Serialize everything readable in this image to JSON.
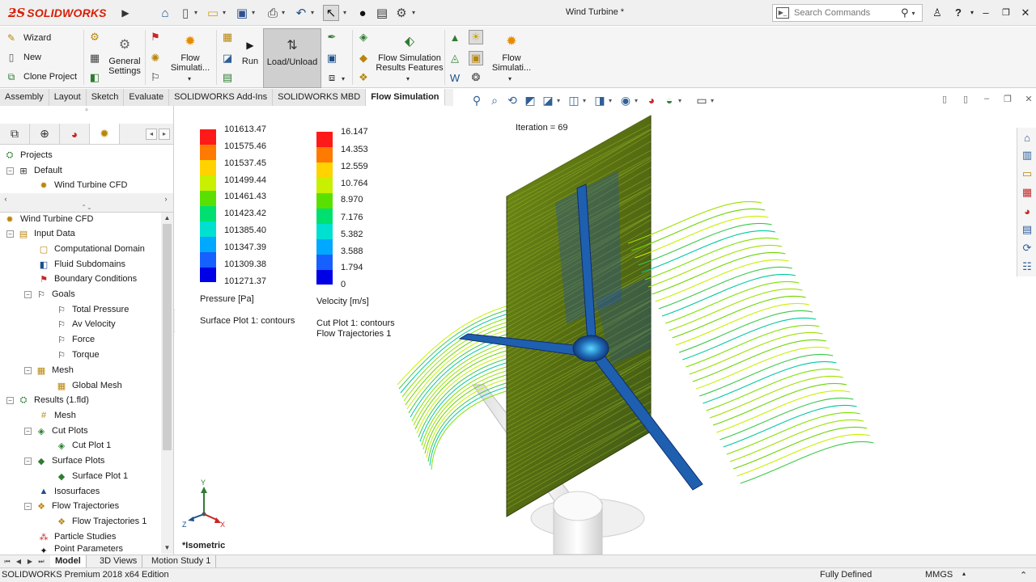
{
  "app": {
    "brand": "SOLIDWORKS",
    "document_title": "Wind Turbine *",
    "search_placeholder": "Search Commands"
  },
  "ribbon": {
    "left_items": [
      "Wizard",
      "New",
      "Clone Project"
    ],
    "general_settings": "General\nSettings",
    "flow_simulation_1": "Flow\nSimulati...",
    "run": "Run",
    "load_unload": "Load/Unload",
    "results_features": "Flow Simulation\nResults Features",
    "flow_simulation_2": "Flow\nSimulati..."
  },
  "tabs": [
    {
      "label": "Assembly",
      "active": false
    },
    {
      "label": "Layout",
      "active": false
    },
    {
      "label": "Sketch",
      "active": false
    },
    {
      "label": "Evaluate",
      "active": false
    },
    {
      "label": "SOLIDWORKS Add-Ins",
      "active": false
    },
    {
      "label": "SOLIDWORKS MBD",
      "active": false
    },
    {
      "label": "Flow Simulation",
      "active": true
    }
  ],
  "projects_tree": [
    {
      "label": "Projects",
      "level": 0,
      "icon": "projects-icon"
    },
    {
      "label": "Default",
      "level": 1,
      "icon": "config-icon"
    },
    {
      "label": "Wind Turbine CFD",
      "level": 2,
      "icon": "project-icon"
    }
  ],
  "analysis_tree": [
    {
      "label": "Wind Turbine CFD",
      "level": 0,
      "icon": "project-icon"
    },
    {
      "label": "Input Data",
      "level": 1,
      "icon": "input-data-icon"
    },
    {
      "label": "Computational Domain",
      "level": 2,
      "icon": "domain-icon"
    },
    {
      "label": "Fluid Subdomains",
      "level": 2,
      "icon": "subdomain-icon"
    },
    {
      "label": "Boundary Conditions",
      "level": 2,
      "icon": "boundary-icon"
    },
    {
      "label": "Goals",
      "level": 2,
      "icon": "goals-icon"
    },
    {
      "label": "Total Pressure",
      "level": 3,
      "icon": "goal-flag-icon"
    },
    {
      "label": "Av Velocity",
      "level": 3,
      "icon": "goal-flag-icon"
    },
    {
      "label": "Force",
      "level": 3,
      "icon": "goal-flag-icon"
    },
    {
      "label": "Torque",
      "level": 3,
      "icon": "goal-flag-icon"
    },
    {
      "label": "Mesh",
      "level": 2,
      "icon": "mesh-icon"
    },
    {
      "label": "Global Mesh",
      "level": 3,
      "icon": "global-mesh-icon"
    },
    {
      "label": "Results (1.fld)",
      "level": 1,
      "icon": "results-icon"
    },
    {
      "label": "Mesh",
      "level": 2,
      "icon": "mesh-icon"
    },
    {
      "label": "Cut Plots",
      "level": 2,
      "icon": "cut-plots-icon"
    },
    {
      "label": "Cut Plot 1",
      "level": 3,
      "icon": "cut-plot-icon"
    },
    {
      "label": "Surface Plots",
      "level": 2,
      "icon": "surface-plots-icon"
    },
    {
      "label": "Surface Plot 1",
      "level": 3,
      "icon": "surface-plot-icon"
    },
    {
      "label": "Isosurfaces",
      "level": 2,
      "icon": "isosurfaces-icon"
    },
    {
      "label": "Flow Trajectories",
      "level": 2,
      "icon": "flow-trajectories-icon"
    },
    {
      "label": "Flow Trajectories 1",
      "level": 3,
      "icon": "flow-trajectory-icon"
    },
    {
      "label": "Particle Studies",
      "level": 2,
      "icon": "particle-studies-icon"
    },
    {
      "label": "Point Parameters",
      "level": 2,
      "icon": "point-parameters-icon"
    }
  ],
  "graphics": {
    "iteration": "Iteration = 69",
    "view_name": "*Isometric",
    "pressure_legend": {
      "values": [
        "101613.47",
        "101575.46",
        "101537.45",
        "101499.44",
        "101461.43",
        "101423.42",
        "101385.40",
        "101347.39",
        "101309.38",
        "101271.37"
      ],
      "title": "Pressure [Pa]",
      "subtitle": "Surface Plot 1: contours"
    },
    "velocity_legend": {
      "values": [
        "16.147",
        "14.353",
        "12.559",
        "10.764",
        "8.970",
        "7.176",
        "5.382",
        "3.588",
        "1.794",
        "0"
      ],
      "title": "Velocity [m/s]",
      "subtitle_1": "Cut Plot 1: contours",
      "subtitle_2": "Flow Trajectories 1"
    },
    "legend_colors": [
      "#ff1a1a",
      "#ff7a00",
      "#ffd200",
      "#c8f000",
      "#5ae000",
      "#00e070",
      "#00e0d0",
      "#00a8ff",
      "#1660ff",
      "#0000e6"
    ],
    "triad": {
      "x": "X",
      "y": "Y",
      "z": "Z"
    }
  },
  "bottom_tabs": [
    {
      "label": "Model",
      "active": true
    },
    {
      "label": "3D Views",
      "active": false
    },
    {
      "label": "Motion Study 1",
      "active": false
    }
  ],
  "status": {
    "edition": "SOLIDWORKS Premium 2018 x64 Edition",
    "state": "Fully Defined",
    "units": "MMGS"
  }
}
